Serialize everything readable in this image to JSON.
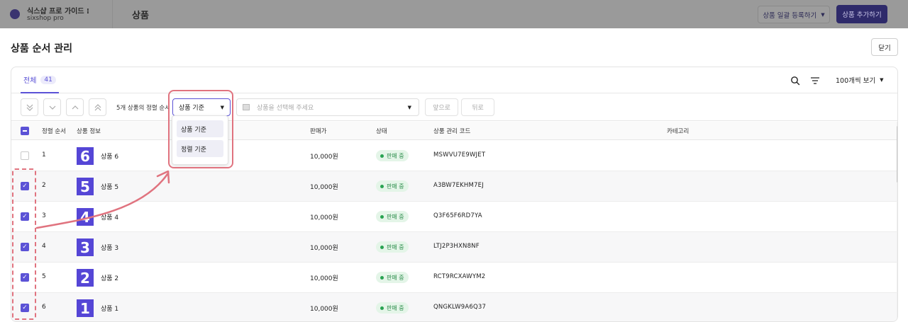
{
  "topbar": {
    "store_name": "식스샵 프로 가이드 ⁝",
    "store_sub": "sixshop pro",
    "page_title": "상품",
    "bulk_button": "상품 일괄 등록하기",
    "add_button": "상품 추가하기"
  },
  "modal": {
    "title": "상품 순서 관리",
    "close_label": "닫기"
  },
  "tabs": {
    "all_label": "전체",
    "all_count": "41",
    "per_page": "100개씩 보기"
  },
  "toolbar": {
    "sort_hint": "5개 상품의 정렬 순서",
    "basis_select": "상품 기준",
    "product_placeholder": "상품을 선택해 주세요",
    "front_label": "앞으로",
    "back_label": "뒤로"
  },
  "dropdown": {
    "options": [
      "상품 기준",
      "정렬 기준"
    ]
  },
  "table": {
    "headers": {
      "order": "정렬 순서",
      "info": "상품 정보",
      "price": "판매가",
      "status": "상태",
      "code": "상품 관리 코드",
      "category": "카테고리"
    },
    "rows": [
      {
        "checked": false,
        "order": "1",
        "img": "6",
        "name": "상품 6",
        "price": "10,000원",
        "status": "판매 중",
        "code": "MSWVU7E9WJET"
      },
      {
        "checked": true,
        "order": "2",
        "img": "5",
        "name": "상품 5",
        "price": "10,000원",
        "status": "판매 중",
        "code": "A3BW7EKHM7EJ"
      },
      {
        "checked": true,
        "order": "3",
        "img": "4",
        "name": "상품 4",
        "price": "10,000원",
        "status": "판매 중",
        "code": "Q3F65F6RD7YA"
      },
      {
        "checked": true,
        "order": "4",
        "img": "3",
        "name": "상품 3",
        "price": "10,000원",
        "status": "판매 중",
        "code": "LTJ2P3HXN8NF"
      },
      {
        "checked": true,
        "order": "5",
        "img": "2",
        "name": "상품 2",
        "price": "10,000원",
        "status": "판매 중",
        "code": "RCT9RCXAWYM2"
      },
      {
        "checked": true,
        "order": "6",
        "img": "1",
        "name": "상품 1",
        "price": "10,000원",
        "status": "판매 중",
        "code": "QNGKLW9A6Q37"
      }
    ]
  },
  "colors": {
    "accent": "#5b52d6",
    "annotation": "#e0737f",
    "status_bg": "#e4f5e8",
    "status_text": "#2a8c4a"
  }
}
